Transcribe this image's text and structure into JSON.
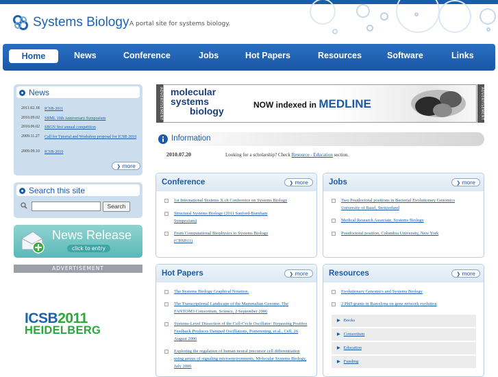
{
  "header": {
    "brand": "Systems Biology",
    "tagline": "A portal site for systems biology."
  },
  "nav": [
    "Home",
    "News",
    "Conference",
    "Jobs",
    "Hot Papers",
    "Resources",
    "Software",
    "Links"
  ],
  "news": {
    "title": "News",
    "items": [
      {
        "date": "2011.02.18",
        "text": "ICSB-2011"
      },
      {
        "date": "2010.09.02",
        "text": "SBML 10th Anniversary Symposium"
      },
      {
        "date": "2010.06.02",
        "text": "SBGN first annual competition"
      },
      {
        "date": "2009.11.27",
        "text": "Call for Tutorial and Workshop proposal for ICSB 2010"
      },
      {
        "date": "2009.09.10",
        "text": "ICSB-2010"
      }
    ],
    "more": "more"
  },
  "search": {
    "title": "Search this site",
    "button": "Search",
    "value": ""
  },
  "news_release": {
    "title": "News Release",
    "sub": "click to entry"
  },
  "advertisement_label": "ADVERTISEMENT",
  "left_ad": {
    "line1": "ICSB2011",
    "line2": "HEIDELBERG",
    "accent": "#2aa839",
    "blue": "#1b63b0"
  },
  "banner": {
    "side_label": "ADVERTISEMENT",
    "brand1": "molecular",
    "brand2": "systems",
    "brand3": "biology",
    "text": "NOW indexed in",
    "highlight": "MEDLINE"
  },
  "information": {
    "title": "Information",
    "date": "2010.07.20",
    "text_before": "Looking for a scholarship? Check",
    "link": "Resource - Education",
    "text_after": "section."
  },
  "conference": {
    "title": "Conference",
    "more": "more",
    "items": [
      "1st International Systems X.ch Conference on Systems Biology",
      "Structural Systems Biology (2011 Sanford-Burnham Symposium)",
      "From Computational Biophysics to Systems Biology (CBSB11)"
    ]
  },
  "jobs": {
    "title": "Jobs",
    "more": "more",
    "items": [
      "Two Postdoctoral positions in Bacterial Evolutionary Genomics University of Basel, Switzerland",
      "Medical Research Associate, Systems Biology",
      "Postdoctoral position, Columbia University, New York"
    ]
  },
  "hot_papers": {
    "title": "Hot Papers",
    "more": "more",
    "items": [
      "The Systems Biology Graphical Notation.",
      "The Transcriptional Landscape of the Mammalian Genome. The FANTOM3 Consortium, Science, 2 September 2006",
      "Systems-Level Dissection of the Cell-Cycle Oscillator: Bypassing Positive Feedback Produces Damped Oscillations, Pomerening, et al., Cell, 26 August 2006",
      "Exploring the regulation of human neural precursor cell differentiation using arrays of signaling microenvironments, Molecular Systems Biology, July 2006"
    ]
  },
  "resources": {
    "title": "Resources",
    "more": "more",
    "items": [
      "Evolutionary Genomics and Systems Biology",
      "2 PhD grants in Barcelona on gene network evolution"
    ],
    "categories": [
      "Books",
      "Consortium",
      "Education",
      "Funding"
    ]
  }
}
